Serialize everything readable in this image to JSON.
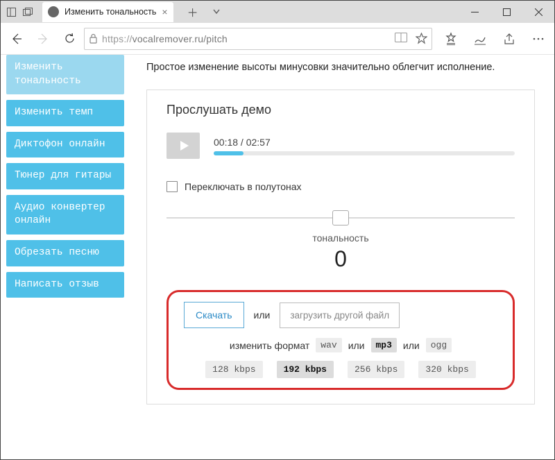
{
  "window": {
    "tab_title": "Изменить тональность",
    "url_protocol": "https://",
    "url_rest": "vocalremover.ru/pitch"
  },
  "sidebar": {
    "items": [
      {
        "label": "Изменить тональность"
      },
      {
        "label": "Изменить темп"
      },
      {
        "label": "Диктофон онлайн"
      },
      {
        "label": "Тюнер для гитары"
      },
      {
        "label": "Аудио конвертер онлайн"
      },
      {
        "label": "Обрезать песню"
      },
      {
        "label": "Написать отзыв"
      }
    ]
  },
  "main": {
    "subtitle": "Простое изменение высоты минусовки значительно облегчит исполнение.",
    "demo_title": "Прослушать демо",
    "time": "00:18 / 02:57",
    "semitone_label": "Переключать в полутонах",
    "tonality_label": "тональность",
    "tonality_value": "0",
    "download_label": "Скачать",
    "or_label": "или",
    "upload_label": "загрузить другой файл",
    "format_prefix": "изменить формат",
    "formats": [
      "wav",
      "mp3",
      "ogg"
    ],
    "format_selected": "mp3",
    "rates": [
      "128 kbps",
      "192 kbps",
      "256 kbps",
      "320 kbps"
    ],
    "rate_selected": "192 kbps"
  }
}
